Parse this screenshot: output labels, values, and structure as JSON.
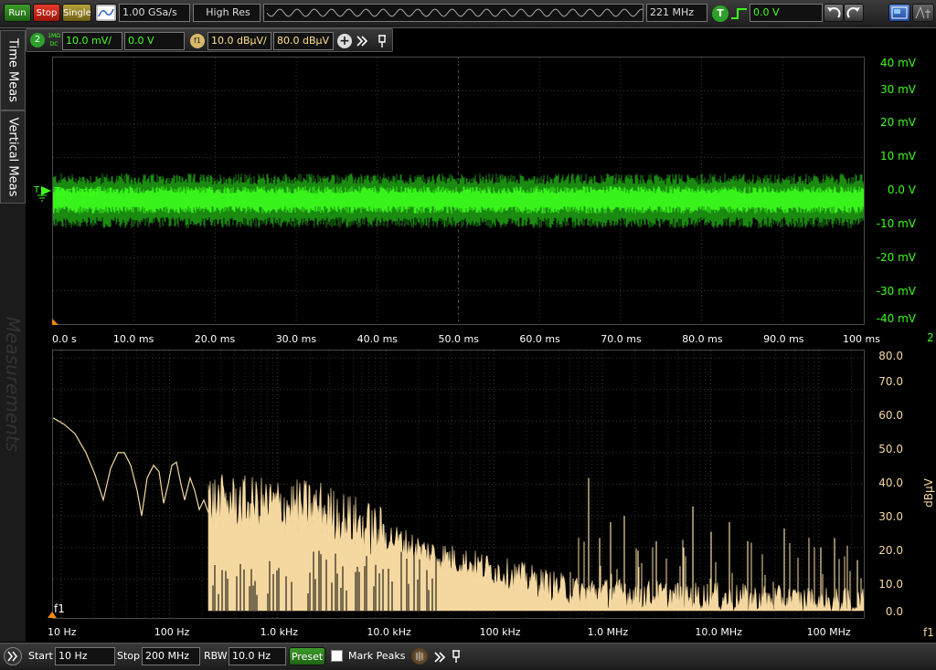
{
  "toolbar": {
    "run_label": "Run",
    "stop_label": "Stop",
    "single_label": "Single",
    "sample_rate": "1.00 GSa/s",
    "acq_mode": "High Res",
    "bandwidth": "221 MHz",
    "trigger_label": "T",
    "trigger_level": "0.0 V"
  },
  "channel": {
    "number": "2",
    "coupling_top": "1MΩ",
    "coupling_bottom": "DC",
    "scale": "10.0 mV/",
    "offset": "0.0 V",
    "fft_label": "f1",
    "fft_scale": "10.0 dBµV/",
    "fft_ref": "80.0 dBµV"
  },
  "side_tabs": {
    "time_meas": "Time Meas",
    "vertical_meas": "Vertical Meas",
    "measurements": "Measurements"
  },
  "time_plot": {
    "waveform_label": "Tastkopf",
    "trigger_marker": "T",
    "channel_marker": "2",
    "y_ticks": [
      "40 mV",
      "30 mV",
      "20 mV",
      "10 mV",
      "0.0 V",
      "-10 mV",
      "-20 mV",
      "-30 mV",
      "-40 mV"
    ],
    "x_ticks": [
      "0.0 s",
      "10.0 ms",
      "20.0 ms",
      "30.0 ms",
      "40.0 ms",
      "50.0 ms",
      "60.0 ms",
      "70.0 ms",
      "80.0 ms",
      "90.0 ms",
      "100 ms"
    ],
    "colors": {
      "trace_bright": "#3cff1c",
      "trace_dark": "#1a8a10"
    }
  },
  "freq_plot": {
    "marker": "f1",
    "unit": "dBµV",
    "y_ticks": [
      "80.0",
      "70.0",
      "60.0",
      "50.0",
      "40.0",
      "30.0",
      "20.0",
      "10.0",
      "0.0"
    ],
    "x_ticks": [
      "10 Hz",
      "100 Hz",
      "1.0 kHz",
      "10.0 kHz",
      "100 kHz",
      "1.0 MHz",
      "10.0 MHz",
      "100 MHz"
    ],
    "right_marker": "f1",
    "colors": {
      "trace": "#f5d8a0"
    }
  },
  "bottom_bar": {
    "start_label": "Start",
    "start_value": "10 Hz",
    "stop_label": "Stop",
    "stop_value": "200 MHz",
    "rbw_label": "RBW",
    "rbw_value": "10.0 Hz",
    "preset_label": "Preset",
    "mark_peaks_label": "Mark Peaks"
  }
}
